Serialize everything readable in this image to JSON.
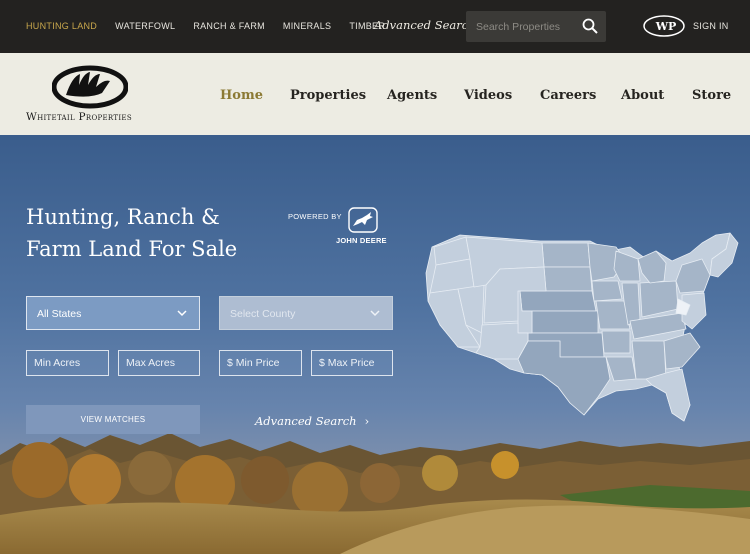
{
  "topbar": {
    "nav_items": [
      "Hunting Land",
      "Waterfowl",
      "Ranch & Farm",
      "Minerals",
      "Timber"
    ],
    "advanced_search": "Advanced Search",
    "search_placeholder": "Search Properties",
    "wp_logo_text": "WP",
    "sign_in": "SIGN IN"
  },
  "header": {
    "logo_text": "Whitetail Properties",
    "nav_items": [
      "Home",
      "Properties",
      "Agents",
      "Videos",
      "Careers",
      "About",
      "Store"
    ],
    "active_item": "Home"
  },
  "hero": {
    "title_line1": "Hunting, Ranch &",
    "title_line2": "Farm Land For Sale",
    "powered_by": "POWERED BY",
    "sponsor": "JOHN DEERE",
    "state_select": "All States",
    "county_select": "Select County",
    "min_acres_placeholder": "Min Acres",
    "max_acres_placeholder": "Max Acres",
    "min_price_placeholder": "$ Min Price",
    "max_price_placeholder": "$ Max Price",
    "view_matches": "VIEW MATCHES",
    "advanced_search": "Advanced Search"
  },
  "colors": {
    "topbar_bg": "#232220",
    "active_top": "#c9a84c",
    "header_bg": "#edece3",
    "active_main": "#8c7a34",
    "map_fill": "#c3cfdd",
    "map_highlight": "#93a6bd"
  }
}
